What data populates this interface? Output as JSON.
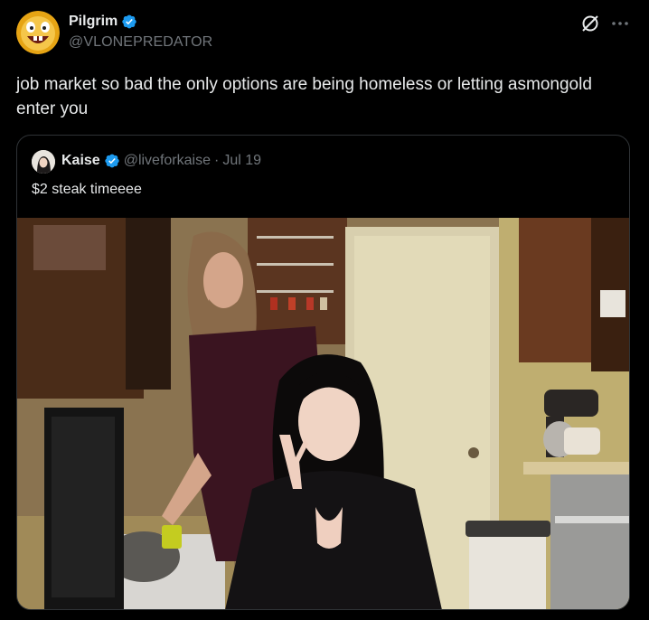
{
  "author": {
    "name": "Pilgrim",
    "handle": "@VLONEPREDATOR",
    "verified": true,
    "avatar_icon": "laughing-face-avatar"
  },
  "actions": {
    "grok_icon": "grok-icon",
    "more_icon": "more-options-icon"
  },
  "post": {
    "text": "job market so bad the only options are being homeless or letting asmongold enter you"
  },
  "quote": {
    "name": "Kaise",
    "handle": "@liveforkaise",
    "separator": "·",
    "date": "Jul 19",
    "verified": true,
    "text": "$2 steak timeeee",
    "media_icon": "kitchen-photo"
  },
  "colors": {
    "background": "#000000",
    "primary_text": "#e7e9ea",
    "secondary_text": "#71767b",
    "verified_blue": "#1d9bf0",
    "border": "#2f3336"
  }
}
